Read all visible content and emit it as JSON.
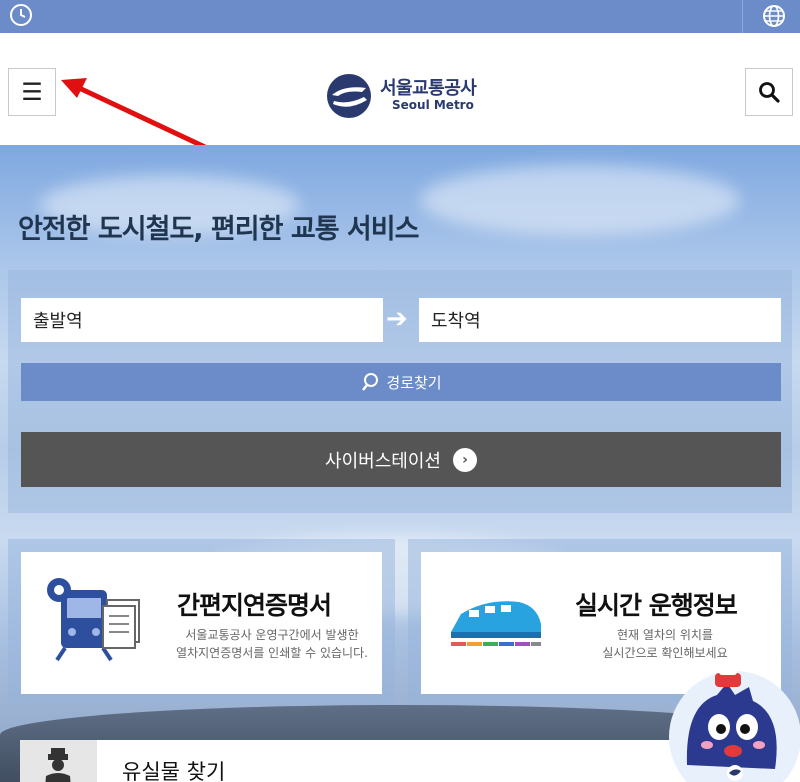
{
  "header": {
    "logo_kr": "서울교통공사",
    "logo_en": "Seoul Metro"
  },
  "icons": {
    "clock": "clock-icon",
    "globe": "globe-icon",
    "menu": "☰",
    "search": "search-icon"
  },
  "hero": {
    "slogan": "안전한 도시철도, 편리한 교통 서비스"
  },
  "route_search": {
    "departure_placeholder": "출발역",
    "arrival_placeholder": "도착역",
    "find_label": "경로찾기",
    "cyber_station_label": "사이버스테이션"
  },
  "cards": [
    {
      "title": "간편지연증명서",
      "desc_line1": "서울교통공사 운영구간에서 발생한",
      "desc_line2": "열차지연증명서를 인쇄할 수 있습니다."
    },
    {
      "title": "실시간 운행정보",
      "desc_line1": "현재 열차의 위치를",
      "desc_line2": "실시간으로 확인해보세요"
    }
  ],
  "lost_found": {
    "label": "유실물 찾기"
  },
  "colors": {
    "accent": "#6b8cc9",
    "dark_button": "#555555",
    "brand_navy": "#2a3a6e",
    "arrow_red": "#e01010"
  }
}
